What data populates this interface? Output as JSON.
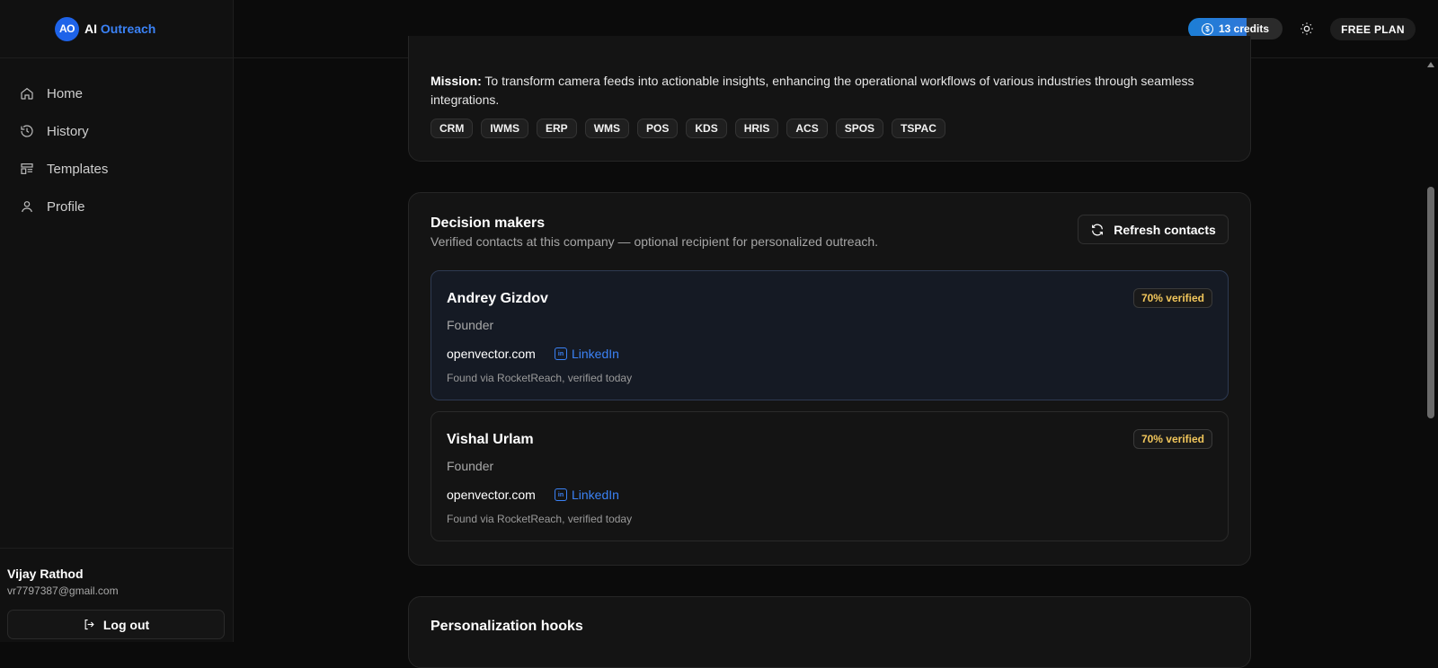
{
  "brand": {
    "badge": "AO",
    "ai": "AI",
    "outreach": "Outreach"
  },
  "nav": [
    {
      "label": "Home",
      "icon": "home-icon"
    },
    {
      "label": "History",
      "icon": "history-icon"
    },
    {
      "label": "Templates",
      "icon": "templates-icon"
    },
    {
      "label": "Profile",
      "icon": "user-icon"
    }
  ],
  "user": {
    "name": "Vijay Rathod",
    "email": "vr7797387@gmail.com",
    "logout_label": "Log out"
  },
  "topbar": {
    "credits_label": "13 credits",
    "plan_label": "FREE PLAN"
  },
  "mission": {
    "label": "Mission:",
    "text": "To transform camera feeds into actionable insights, enhancing the operational workflows of various industries through seamless integrations.",
    "tags": [
      "CRM",
      "IWMS",
      "ERP",
      "WMS",
      "POS",
      "KDS",
      "HRIS",
      "ACS",
      "SPOS",
      "TSPAC"
    ]
  },
  "decision_makers": {
    "title": "Decision makers",
    "subtitle": "Verified contacts at this company — optional recipient for personalized outreach.",
    "refresh_label": "Refresh contacts",
    "contacts": [
      {
        "name": "Andrey Gizdov",
        "role": "Founder",
        "domain": "openvector.com",
        "link_label": "LinkedIn",
        "found": "Found via RocketReach, verified today",
        "verified": "70% verified"
      },
      {
        "name": "Vishal Urlam",
        "role": "Founder",
        "domain": "openvector.com",
        "link_label": "LinkedIn",
        "found": "Found via RocketReach, verified today",
        "verified": "70% verified"
      }
    ]
  },
  "hooks": {
    "title": "Personalization hooks"
  }
}
